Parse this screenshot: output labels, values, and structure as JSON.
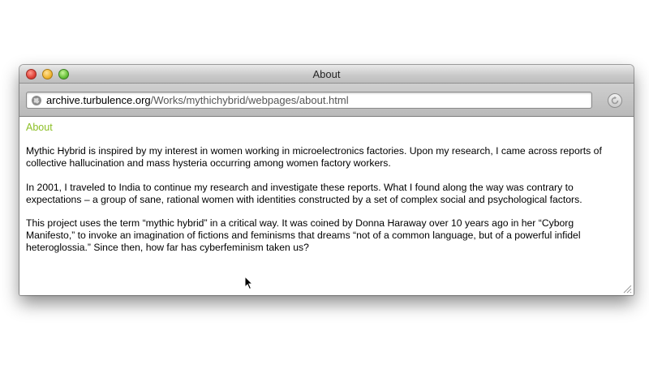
{
  "window": {
    "title": "About"
  },
  "address_bar": {
    "url_domain": "archive.turbulence.org",
    "url_path": "/Works/mythichybrid/webpages/about.html"
  },
  "page": {
    "heading": "About",
    "heading_color": "#8cbf26",
    "paragraphs": [
      "Mythic Hybrid is inspired by my interest in women working in microelectronics factories. Upon my research, I came across reports of collective hallucination and mass hysteria occurring among women factory workers.",
      "In 2001, I traveled to India to continue my research and investigate these reports. What I found along the way was contrary to expectations – a group of sane, rational women with identities constructed by a set of complex social and psychological factors.",
      "This project uses the term “mythic hybrid” in a critical way. It was coined by Donna Haraway over 10 years ago in her “Cyborg Manifesto,” to invoke an imagination of fictions and feminisms that dreams “not of a common language, but of a powerful infidel heteroglossia.” Since then, how far has cyberfeminism taken us?"
    ]
  },
  "icons": {
    "close": "close-button-icon",
    "minimize": "minimize-button-icon",
    "maximize": "zoom-button-icon",
    "site": "globe-icon",
    "reload": "reload-icon",
    "resize": "resize-grip-icon",
    "pointer": "mouse-cursor-icon"
  }
}
